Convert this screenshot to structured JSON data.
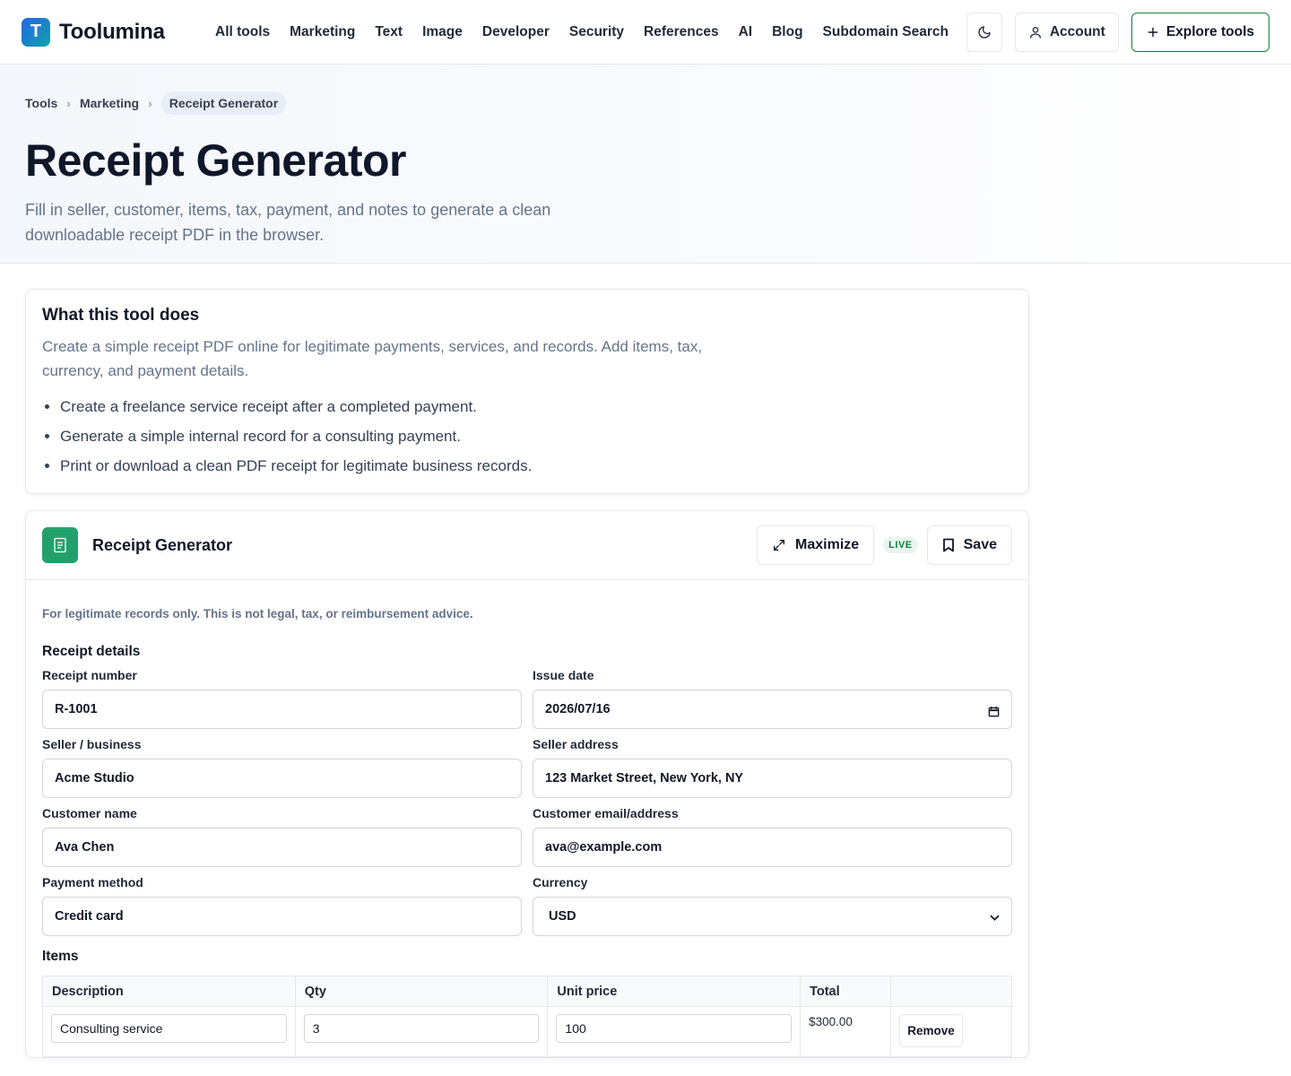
{
  "brand": {
    "logo_letter": "T",
    "name": "Toolumina"
  },
  "nav": [
    "All tools",
    "Marketing",
    "Text",
    "Image",
    "Developer",
    "Security",
    "References",
    "AI",
    "Blog",
    "Subdomain Search"
  ],
  "header": {
    "theme_icon": "moon-icon",
    "account_label": "Account",
    "explore_label": "Explore tools"
  },
  "breadcrumb": {
    "items": [
      "Tools",
      "Marketing"
    ],
    "current": "Receipt Generator"
  },
  "page": {
    "title": "Receipt Generator",
    "subtitle": "Fill in seller, customer, items, tax, payment, and notes to generate a clean downloadable receipt PDF in the browser."
  },
  "about": {
    "title": "What this tool does",
    "description": "Create a simple receipt PDF online for legitimate payments, services, and records. Add items, tax, currency, and payment details.",
    "bullets": [
      "Create a freelance service receipt after a completed payment.",
      "Generate a simple internal record for a consulting payment.",
      "Print or download a clean PDF receipt for legitimate business records."
    ]
  },
  "tool": {
    "name": "Receipt Generator",
    "maximize_label": "Maximize",
    "live_badge": "LIVE",
    "save_label": "Save",
    "disclaimer": "For legitimate records only. This is not legal, tax, or reimbursement advice.",
    "details_title": "Receipt details",
    "fields": {
      "receipt_number": {
        "label": "Receipt number",
        "value": "R-1001"
      },
      "issue_date": {
        "label": "Issue date",
        "value": "2026/07/16"
      },
      "seller": {
        "label": "Seller / business",
        "value": "Acme Studio"
      },
      "seller_address": {
        "label": "Seller address",
        "value": "123 Market Street, New York, NY"
      },
      "customer_name": {
        "label": "Customer name",
        "value": "Ava Chen"
      },
      "customer_contact": {
        "label": "Customer email/address",
        "value": "ava@example.com"
      },
      "payment_method": {
        "label": "Payment method",
        "value": "Credit card"
      },
      "currency": {
        "label": "Currency",
        "value": "USD"
      }
    },
    "items_title": "Items",
    "items_columns": [
      "Description",
      "Qty",
      "Unit price",
      "Total",
      ""
    ],
    "items": [
      {
        "description": "Consulting service",
        "qty": "3",
        "unit_price": "100",
        "total": "$300.00",
        "remove_label": "Remove"
      }
    ]
  }
}
